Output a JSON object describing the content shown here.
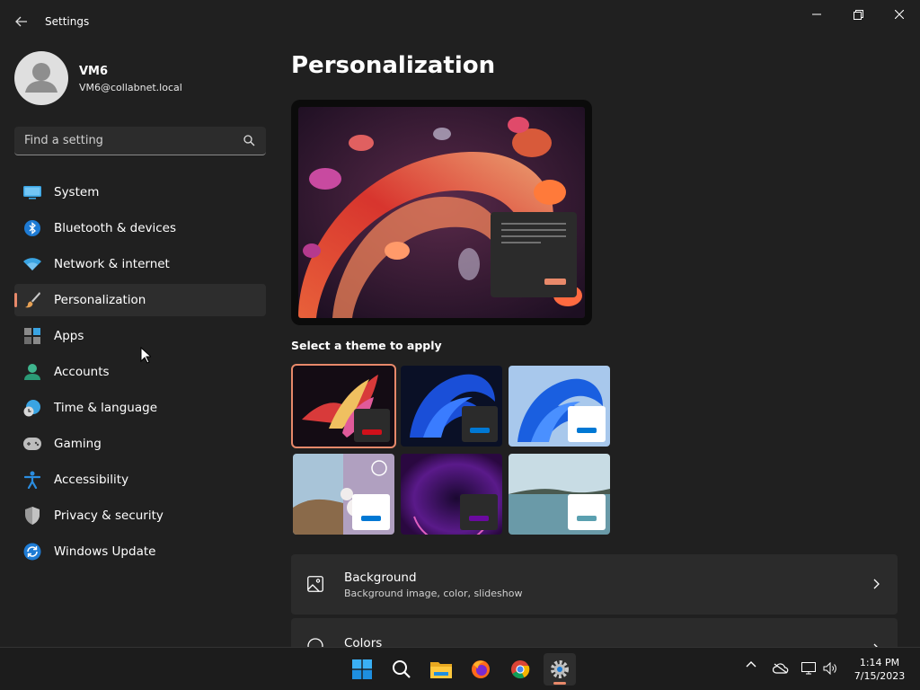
{
  "window": {
    "title": "Settings"
  },
  "user": {
    "name": "VM6",
    "email": "VM6@collabnet.local"
  },
  "search": {
    "placeholder": "Find a setting"
  },
  "nav": [
    {
      "label": "System",
      "icon": "monitor-icon"
    },
    {
      "label": "Bluetooth & devices",
      "icon": "bluetooth-icon"
    },
    {
      "label": "Network & internet",
      "icon": "wifi-icon"
    },
    {
      "label": "Personalization",
      "icon": "brush-icon",
      "active": true
    },
    {
      "label": "Apps",
      "icon": "apps-icon"
    },
    {
      "label": "Accounts",
      "icon": "person-icon"
    },
    {
      "label": "Time & language",
      "icon": "clock-globe-icon"
    },
    {
      "label": "Gaming",
      "icon": "gamepad-icon"
    },
    {
      "label": "Accessibility",
      "icon": "accessibility-icon"
    },
    {
      "label": "Privacy & security",
      "icon": "shield-icon"
    },
    {
      "label": "Windows Update",
      "icon": "update-icon"
    }
  ],
  "main": {
    "title": "Personalization",
    "themes_label": "Select a theme to apply",
    "cards": [
      {
        "title": "Background",
        "subtitle": "Background image, color, slideshow",
        "icon": "image-icon"
      },
      {
        "title": "Colors",
        "icon": "palette-icon"
      }
    ]
  },
  "taskbar": {
    "apps": [
      "windows-start-icon",
      "search-icon",
      "file-explorer-icon",
      "firefox-icon",
      "chrome-icon",
      "settings-icon"
    ],
    "time": "1:14 PM",
    "date": "7/15/2023"
  },
  "colors": {
    "accent": "#e8896a",
    "background": "#202020",
    "card": "#2b2b2b"
  }
}
